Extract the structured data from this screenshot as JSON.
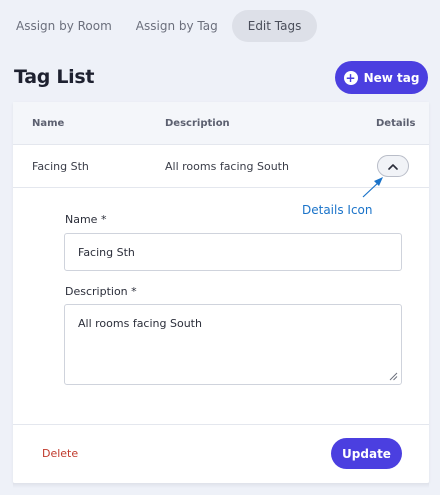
{
  "tabs": [
    {
      "label": "Assign by Room"
    },
    {
      "label": "Assign by Tag"
    },
    {
      "label": "Edit Tags"
    }
  ],
  "page": {
    "title": "Tag List",
    "new_tag_label": "New tag"
  },
  "table": {
    "columns": [
      "Name",
      "Description",
      "Details"
    ],
    "rows": [
      {
        "name": "Facing Sth",
        "description": "All rooms facing South"
      }
    ]
  },
  "annotation": {
    "text": "Details Icon"
  },
  "form": {
    "name_label": "Name *",
    "name_value": "Facing Sth",
    "description_label": "Description *",
    "description_value": "All rooms facing South"
  },
  "actions": {
    "delete_label": "Delete",
    "update_label": "Update"
  },
  "colors": {
    "accent": "#4b3fe0",
    "danger": "#c0392b",
    "annotation": "#1a73c9"
  }
}
